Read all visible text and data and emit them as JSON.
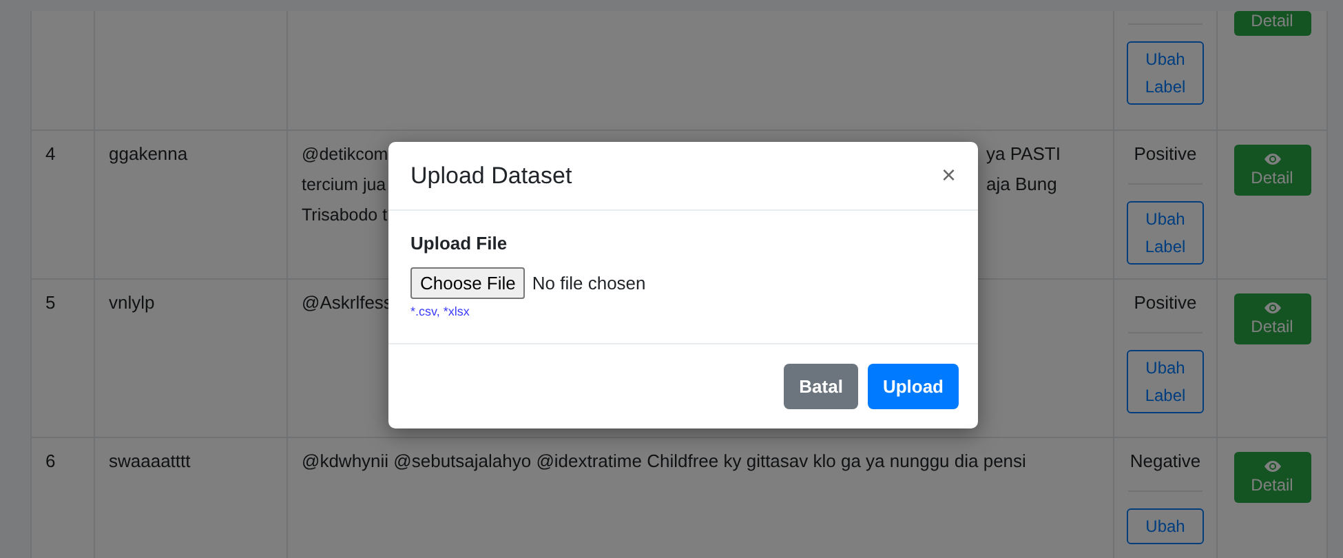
{
  "rows": [
    {
      "kind": "partial",
      "label_button": "Ubah Label",
      "action": "Detail"
    },
    {
      "kind": "full",
      "no": "4",
      "username": "ggakenna",
      "tweet_left": [
        "@detikcom",
        "tercium jua",
        "Trisabodo t"
      ],
      "tweet_right": [
        "ya PASTI",
        "aja Bung"
      ],
      "label": "Positive",
      "label_button": "Ubah Label",
      "action": "Detail"
    },
    {
      "kind": "full",
      "no": "5",
      "username": "vnlylp",
      "tweet_left": [
        "@Askrlfess"
      ],
      "label": "Positive",
      "label_button": "Ubah Label",
      "action": "Detail"
    },
    {
      "kind": "full",
      "no": "6",
      "username": "swaaaatttt",
      "tweet_left": [
        "@kdwhynii @sebutsajalahyo @idextratime Childfree ky gittasav klo ga ya nunggu dia pensi"
      ],
      "label": "Negative",
      "label_button": "Ubah",
      "action": "Detail"
    }
  ],
  "modal": {
    "title": "Upload Dataset",
    "close": "×",
    "field_label": "Upload File",
    "file_button": "Choose File",
    "file_status": "No file chosen",
    "hint": "*.csv, *xlsx",
    "buttons": [
      {
        "label": "Batal",
        "kind": "secondary"
      },
      {
        "label": "Upload",
        "kind": "primary"
      }
    ]
  }
}
